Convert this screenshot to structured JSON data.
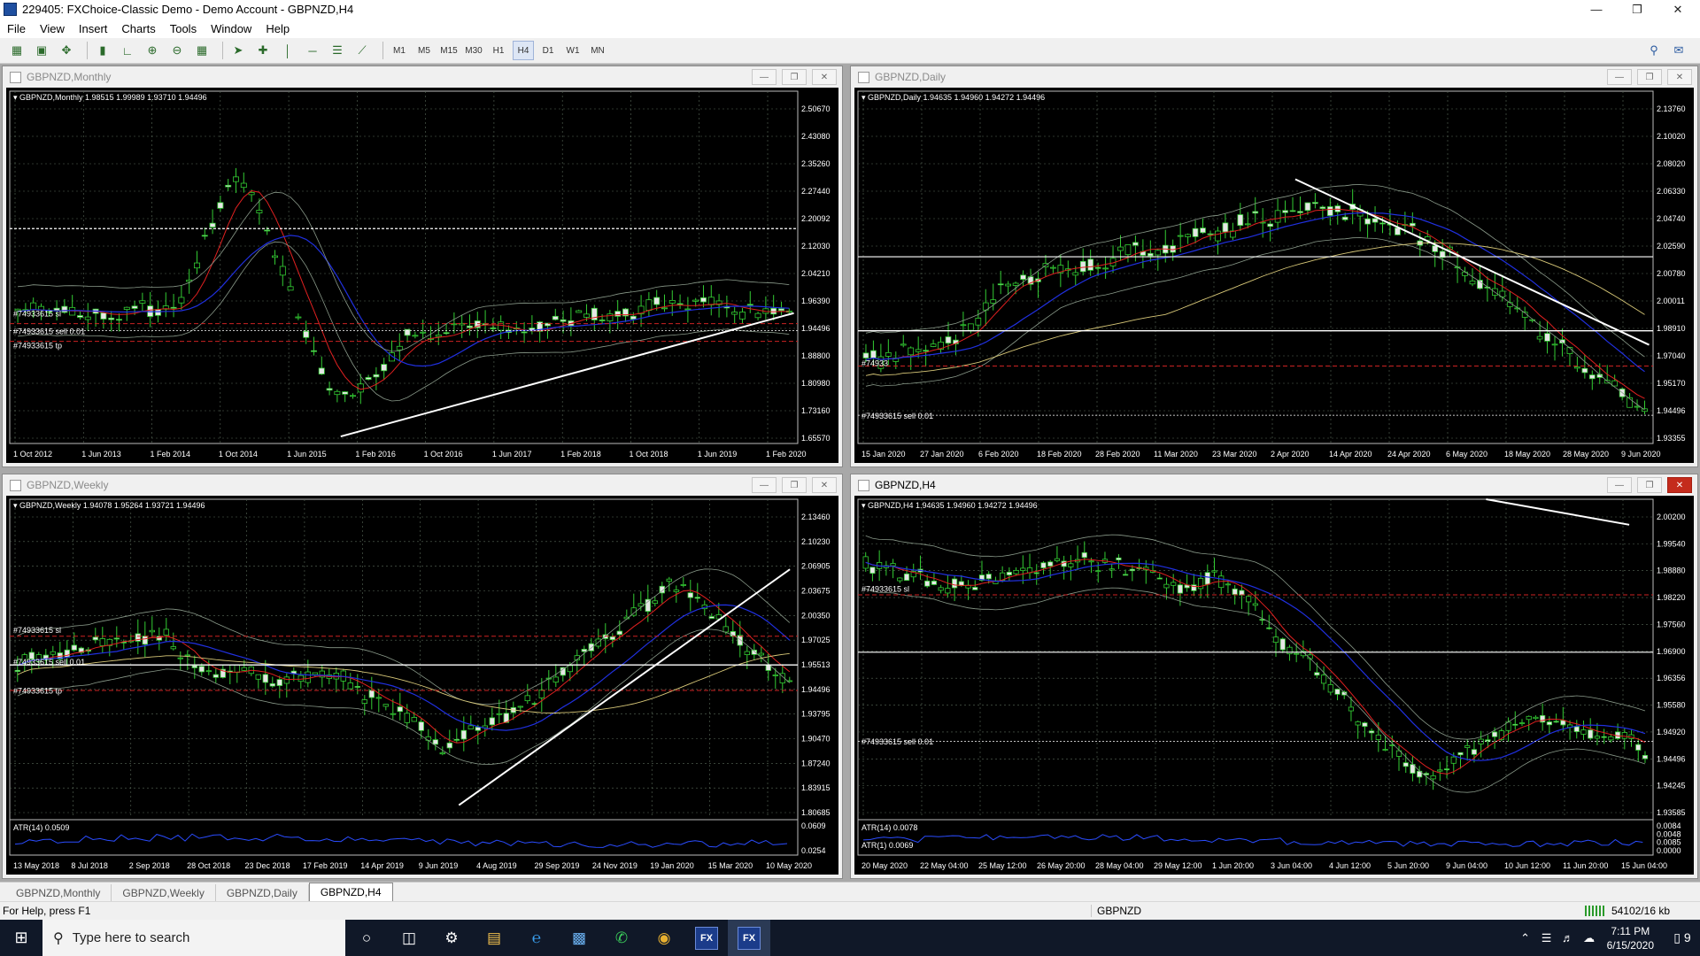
{
  "app": {
    "title": "229405: FXChoice-Classic Demo - Demo Account - GBPNZD,H4"
  },
  "menu": [
    "File",
    "View",
    "Insert",
    "Charts",
    "Tools",
    "Window",
    "Help"
  ],
  "toolbar": {
    "timeframes": [
      "M1",
      "M5",
      "M15",
      "M30",
      "H1",
      "H4",
      "D1",
      "W1",
      "MN"
    ],
    "active_timeframe": "H4"
  },
  "charts": {
    "monthly": {
      "window_title": "GBPNZD,Monthly",
      "info": "GBPNZD,Monthly  1.98515 1.99989 1.93710 1.94496",
      "price_labels": [
        "2.50670",
        "2.43080",
        "2.35260",
        "2.27440",
        "2.20092",
        "2.12030",
        "2.04210",
        "1.96390",
        "1.94496",
        "1.88800",
        "1.80980",
        "1.73160",
        "1.65570"
      ],
      "date_labels": [
        "1 Oct 2012",
        "1 Jun 2013",
        "1 Feb 2014",
        "1 Oct 2014",
        "1 Jun 2015",
        "1 Feb 2016",
        "1 Oct 2016",
        "1 Jun 2017",
        "1 Feb 2018",
        "1 Oct 2018",
        "1 Jun 2019",
        "1 Feb 2020"
      ],
      "order_labels": [
        "#74933615 sl",
        "#74933615 sell 0.01",
        "#74933615 tp"
      ]
    },
    "daily": {
      "window_title": "GBPNZD,Daily",
      "info": "GBPNZD,Daily  1.94635 1.94960 1.94272 1.94496",
      "price_labels": [
        "2.13760",
        "2.10020",
        "2.08020",
        "2.06330",
        "2.04740",
        "2.02590",
        "2.00780",
        "2.00011",
        "1.98910",
        "1.97040",
        "1.95170",
        "1.94496",
        "1.93355"
      ],
      "date_labels": [
        "15 Jan 2020",
        "27 Jan 2020",
        "6 Feb 2020",
        "18 Feb 2020",
        "28 Feb 2020",
        "11 Mar 2020",
        "23 Mar 2020",
        "2 Apr 2020",
        "14 Apr 2020",
        "24 Apr 2020",
        "6 May 2020",
        "18 May 2020",
        "28 May 2020",
        "9 Jun 2020"
      ],
      "order_labels": [
        "#74933",
        "#74933615 sell 0.01"
      ]
    },
    "weekly": {
      "window_title": "GBPNZD,Weekly",
      "info": "GBPNZD,Weekly  1.94078 1.95264 1.93721 1.94496",
      "price_labels": [
        "2.13460",
        "2.10230",
        "2.06905",
        "2.03675",
        "2.00350",
        "1.97025",
        "1.95513",
        "1.94496",
        "1.93795",
        "1.90470",
        "1.87240",
        "1.83915",
        "1.80685"
      ],
      "atr_label": "ATR(14) 0.0509",
      "atr_scale": [
        "0.0609",
        "0.0254"
      ],
      "date_labels": [
        "13 May 2018",
        "8 Jul 2018",
        "2 Sep 2018",
        "28 Oct 2018",
        "23 Dec 2018",
        "17 Feb 2019",
        "14 Apr 2019",
        "9 Jun 2019",
        "4 Aug 2019",
        "29 Sep 2019",
        "24 Nov 2019",
        "19 Jan 2020",
        "15 Mar 2020",
        "10 May 2020"
      ],
      "order_labels": [
        "#74933615 sl",
        "#74933615 sell 0.01",
        "#74933615 tp"
      ]
    },
    "h4": {
      "window_title": "GBPNZD,H4",
      "info": "GBPNZD,H4  1.94635 1.94960 1.94272 1.94496",
      "price_labels": [
        "2.00200",
        "1.99540",
        "1.98880",
        "1.98220",
        "1.97560",
        "1.96900",
        "1.96356",
        "1.95580",
        "1.94920",
        "1.94496",
        "1.94245",
        "1.93585"
      ],
      "atr_label_1": "ATR(14) 0.0078",
      "atr_label_2": "ATR(1) 0.0069",
      "atr_scale": [
        "0.0084",
        "0.0048",
        "0.0085",
        "0.0000"
      ],
      "date_labels": [
        "20 May 2020",
        "22 May 04:00",
        "25 May 12:00",
        "26 May 20:00",
        "28 May 04:00",
        "29 May 12:00",
        "1 Jun 20:00",
        "3 Jun 04:00",
        "4 Jun 12:00",
        "5 Jun 20:00",
        "9 Jun 04:00",
        "10 Jun 12:00",
        "11 Jun 20:00",
        "15 Jun 04:00"
      ],
      "order_labels": [
        "#74933615 sl",
        "#74933615 sell 0.01"
      ]
    }
  },
  "tabs": [
    "GBPNZD,Monthly",
    "GBPNZD,Weekly",
    "GBPNZD,Daily",
    "GBPNZD,H4"
  ],
  "active_tab": 3,
  "status": {
    "help": "For Help, press F1",
    "symbol": "GBPNZD",
    "traffic": "54102/16 kb"
  },
  "taskbar": {
    "search_placeholder": "Type here to search",
    "time": "7:11 PM",
    "date": "6/15/2020",
    "notifications": "9"
  }
}
